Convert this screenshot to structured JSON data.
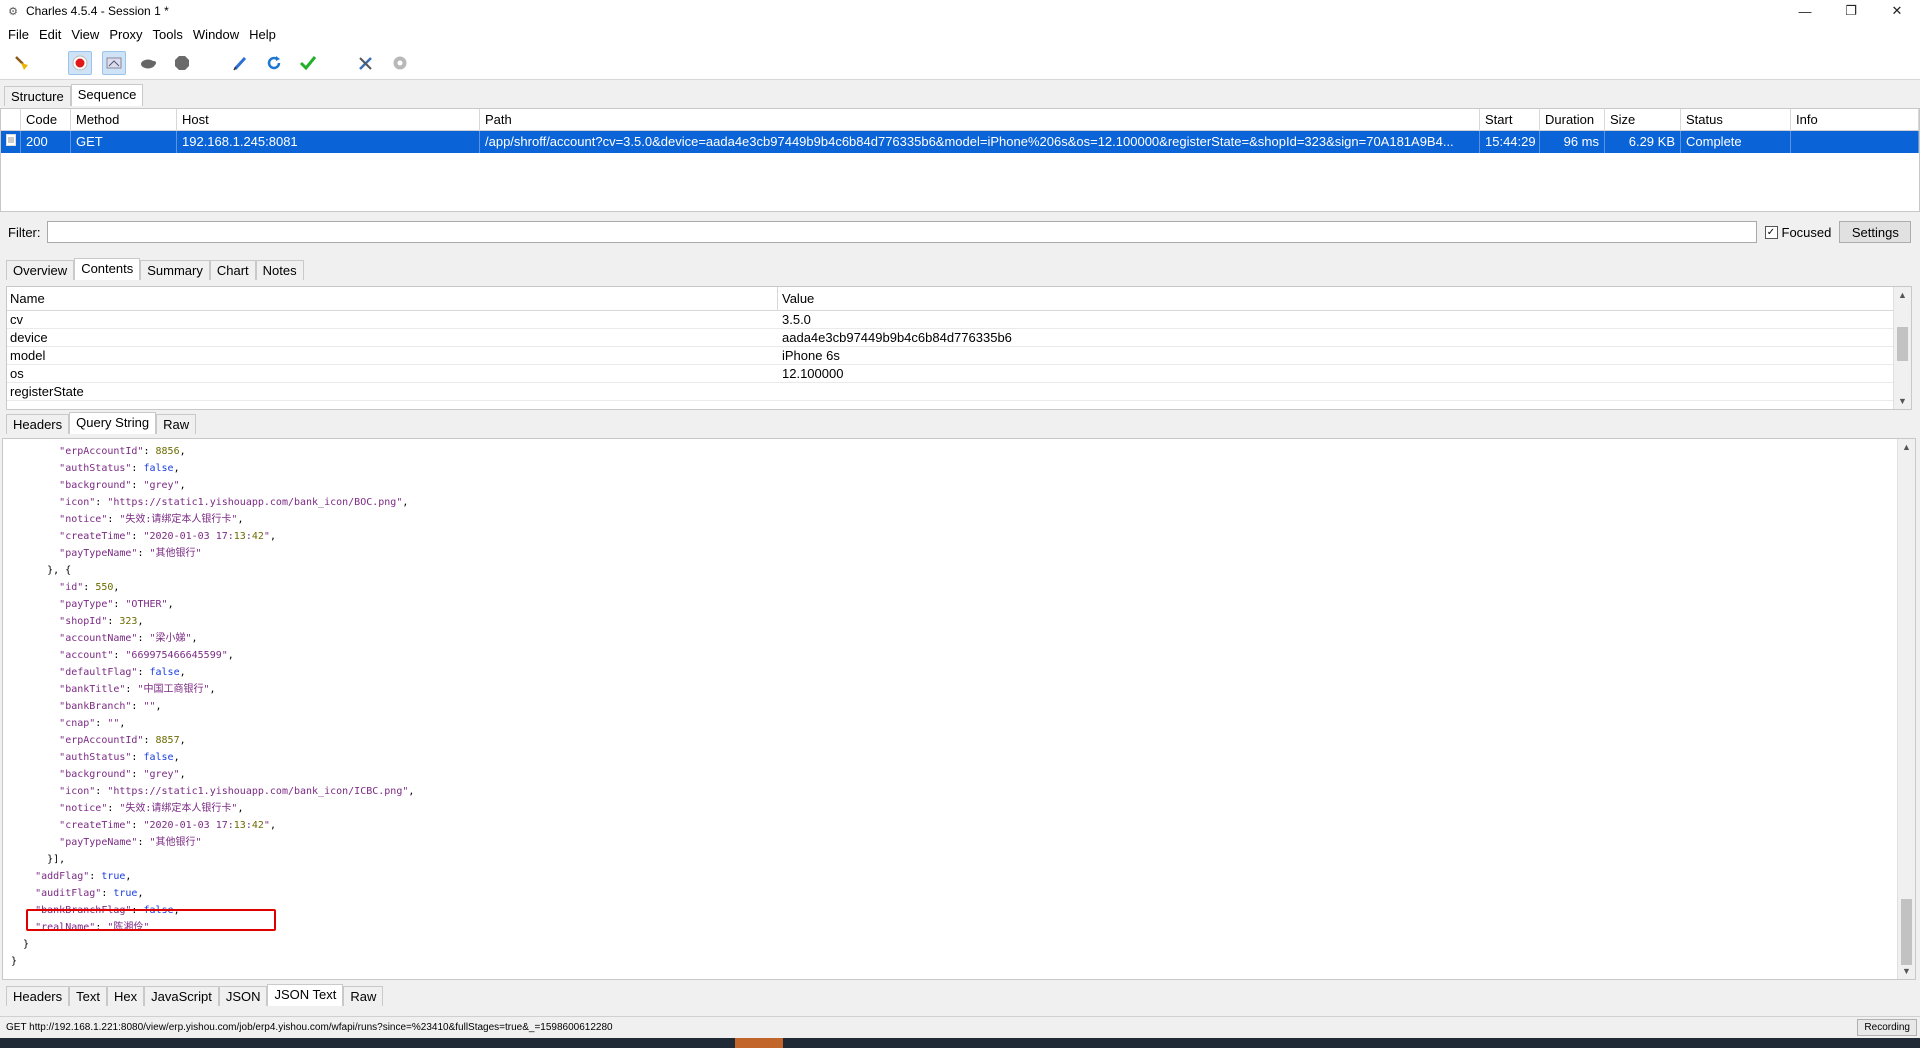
{
  "window": {
    "title": "Charles 4.5.4 - Session 1 *"
  },
  "menu": [
    "File",
    "Edit",
    "View",
    "Proxy",
    "Tools",
    "Window",
    "Help"
  ],
  "toolbar": {
    "icons": [
      "broom-icon",
      "record-icon",
      "throttle-icon",
      "turtle-icon",
      "breakpoint-icon",
      "compose-pen-icon",
      "repeat-icon",
      "validate-check-icon",
      "tools-icon",
      "settings-gear-icon"
    ]
  },
  "view_tabs": {
    "structure": "Structure",
    "sequence": "Sequence"
  },
  "sequence": {
    "columns": {
      "code": "Code",
      "method": "Method",
      "host": "Host",
      "path": "Path",
      "start": "Start",
      "duration": "Duration",
      "size": "Size",
      "status": "Status",
      "info": "Info"
    },
    "rows": [
      {
        "code": "200",
        "method": "GET",
        "host": "192.168.1.245:8081",
        "path": "/app/shroff/account?cv=3.5.0&device=aada4e3cb97449b9b4c6b84d776335b6&model=iPhone%206s&os=12.100000&registerState=&shopId=323&sign=70A181A9B4...",
        "start": "15:44:29",
        "duration": "96 ms",
        "size": "6.29 KB",
        "status": "Complete",
        "info": ""
      }
    ]
  },
  "filter": {
    "label": "Filter:",
    "value": "",
    "focused_label": "Focused",
    "focused_checked": true,
    "settings_label": "Settings"
  },
  "detail_tabs": {
    "overview": "Overview",
    "contents": "Contents",
    "summary": "Summary",
    "chart": "Chart",
    "notes": "Notes"
  },
  "query": {
    "columns": {
      "name": "Name",
      "value": "Value"
    },
    "rows": [
      {
        "name": "cv",
        "value": "3.5.0"
      },
      {
        "name": "device",
        "value": "aada4e3cb97449b9b4c6b84d776335b6"
      },
      {
        "name": "model",
        "value": "iPhone 6s"
      },
      {
        "name": "os",
        "value": "12.100000"
      },
      {
        "name": "registerState",
        "value": ""
      }
    ]
  },
  "request_tabs": {
    "headers": "Headers",
    "query_string": "Query String",
    "raw": "Raw"
  },
  "json_lines": [
    "        \"erpAccountId\": 8856,",
    "        \"authStatus\": false,",
    "        \"background\": \"grey\",",
    "        \"icon\": \"https://static1.yishouapp.com/bank_icon/BOC.png\",",
    "        \"notice\": \"失效:请绑定本人银行卡\",",
    "        \"createTime\": \"2020-01-03 17:13:42\",",
    "        \"payTypeName\": \"其他银行\"",
    "      }, {",
    "        \"id\": 550,",
    "        \"payType\": \"OTHER\",",
    "        \"shopId\": 323,",
    "        \"accountName\": \"梁小娣\",",
    "        \"account\": \"669975466645599\",",
    "        \"defaultFlag\": false,",
    "        \"bankTitle\": \"中国工商银行\",",
    "        \"bankBranch\": \"\",",
    "        \"cnap\": \"\",",
    "        \"erpAccountId\": 8857,",
    "        \"authStatus\": false,",
    "        \"background\": \"grey\",",
    "        \"icon\": \"https://static1.yishouapp.com/bank_icon/ICBC.png\",",
    "        \"notice\": \"失效:请绑定本人银行卡\",",
    "        \"createTime\": \"2020-01-03 17:13:42\",",
    "        \"payTypeName\": \"其他银行\"",
    "      }],",
    "    \"addFlag\": true,",
    "    \"auditFlag\": true,",
    "    \"bankBranchFlag\": false,",
    "    \"realName\": \"陈湘伶\"",
    "  }",
    "}"
  ],
  "response_tabs": {
    "headers": "Headers",
    "text": "Text",
    "hex": "Hex",
    "javascript": "JavaScript",
    "json": "JSON",
    "json_text": "JSON Text",
    "raw": "Raw"
  },
  "status_bar": {
    "text": "GET http://192.168.1.221:8080/view/erp.yishou.com/job/erp4.yishou.com/wfapi/runs?since=%23410&fullStages=true&_=1598600612280",
    "recording": "Recording"
  },
  "colors": {
    "selection": "#0a64d7",
    "highlight_box": "#e00000",
    "json_key": "#7b2a84",
    "json_bool": "#1a3de0",
    "json_number": "#6b6b00"
  }
}
